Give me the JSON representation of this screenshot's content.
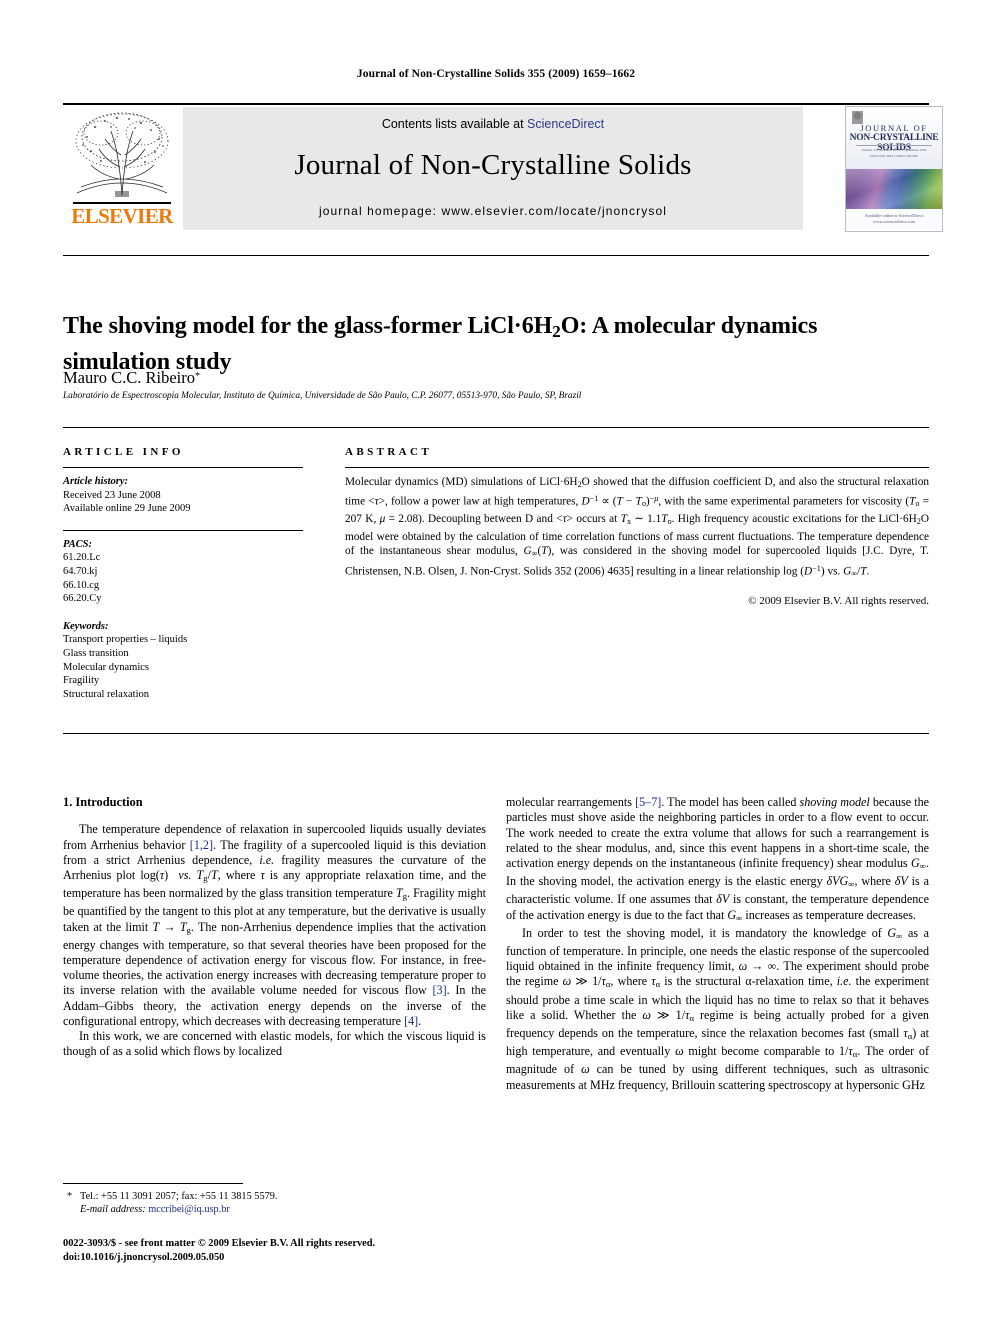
{
  "running_head": "Journal of Non-Crystalline Solids 355 (2009) 1659–1662",
  "masthead": {
    "contents_prefix": "Contents lists available at ",
    "sciencedirect": "ScienceDirect",
    "journal_title": "Journal of Non-Crystalline Solids",
    "homepage": "journal homepage: www.elsevier.com/locate/jnoncrysol",
    "elsevier_wordmark": "ELSEVIER",
    "accent_orange": "#ec7a08",
    "link_blue": "#2b3a8f",
    "band_gray": "#e8e8e8"
  },
  "cover": {
    "line1": "JOURNAL OF",
    "line2": "NON-CRYSTALLINE SOLIDS",
    "meta1": "Volume 355  Numbers 34–36  1 September 2009",
    "meta2": "ISSN 0022-3093  CODEN JNCSBJ",
    "bottom": "Available online at\nScienceDirect\nwww.sciencedirect.com"
  },
  "article": {
    "title_html": "The shoving model for the glass-former LiCl·6H<sub>2</sub>O: A molecular dynamics simulation study",
    "author": "Mauro C.C. Ribeiro",
    "author_marker": "*",
    "affiliation": "Laboratório de Espectroscopia Molecular, Instituto de Química, Universidade de São Paulo, C.P. 26077, 05513-970, São Paulo, SP, Brazil"
  },
  "article_info": {
    "heading": "ARTICLE INFO",
    "history_label": "Article history:",
    "history": [
      "Received 23 June 2008",
      "Available online 29 June 2009"
    ],
    "pacs_label": "PACS:",
    "pacs": [
      "61.20.Lc",
      "64.70.kj",
      "66.10.cg",
      "66.20.Cy"
    ],
    "keywords_label": "Keywords:",
    "keywords": [
      "Transport properties – liquids",
      "Glass transition",
      "Molecular dynamics",
      "Fragility",
      "Structural relaxation"
    ]
  },
  "abstract": {
    "heading": "ABSTRACT",
    "text_html": "Molecular dynamics (MD) simulations of LiCl·6H<sub>2</sub>O showed that the diffusion coefficient D, and also the structural relaxation time &lt;<i class=\"var\">τ</i>&gt;, follow a power law at high temperatures, <i class=\"var\">D</i><sup>−1</sup> ∝ (<i class=\"var\">T</i> − <i class=\"var\">T</i><sub>o</sub>)<sup>−<i class=\"var\">μ</i></sup>, with the same experimental parameters for viscosity (<i class=\"var\">T</i><sub>o</sub> = 207 K, <i class=\"var\">μ</i> = 2.08). Decoupling between D and &lt;<i class=\"var\">τ</i>&gt; occurs at <i class=\"var\">T</i><sub>x</sub> ∼ 1.1<i class=\"var\">T</i><sub>o</sub>. High frequency acoustic excitations for the LiCl·6H<sub>2</sub>O model were obtained by the calculation of time correlation functions of mass current fluctuations. The temperature dependence of the instantaneous shear modulus, <i class=\"var\">G</i><sub>∞</sub>(<i class=\"var\">T</i>), was considered in the shoving model for supercooled liquids [J.C. Dyre, T. Christensen, N.B. Olsen, J. Non-Cryst. Solids 352 (2006) 4635] resulting in a linear relationship log (<i class=\"var\">D</i><sup>−1</sup>) vs. <i class=\"var\">G</i><sub>∞</sub>/<i class=\"var\">T</i>.",
    "copyright": "© 2009 Elsevier B.V. All rights reserved."
  },
  "body": {
    "section_number_title": "1. Introduction",
    "left_paragraphs_html": [
      "The temperature dependence of relaxation in supercooled liquids usually deviates from Arrhenius behavior <span class=\"ref\">[1,2]</span>. The fragility of a supercooled liquid is this deviation from a strict Arrhenius dependence, <i>i.e.</i> fragility measures the curvature of the Arrhenius plot log(<i class=\"var\">τ</i>) &nbsp;<i>vs.</i> <i class=\"var\">T</i><sub>g</sub>/<i class=\"var\">T</i>, where <i class=\"var\">τ</i> is any appropriate relaxation time, and the temperature has been normalized by the glass transition temperature <i class=\"var\">T</i><sub>g</sub>. Fragility might be quantified by the tangent to this plot at any temperature, but the derivative is usually taken at the limit <i class=\"var\">T</i> → <i class=\"var\">T</i><sub>g</sub>. The non-Arrhenius dependence implies that the activation energy changes with temperature, so that several theories have been proposed for the temperature dependence of activation energy for viscous flow. For instance, in free-volume theories, the activation energy increases with decreasing temperature proper to its inverse relation with the available volume needed for viscous flow <span class=\"ref\">[3]</span>. In the Addam–Gibbs theory, the activation energy depends on the inverse of the configurational entropy, which decreases with decreasing temperature <span class=\"ref\">[4]</span>.",
      "In this work, we are concerned with elastic models, for which the viscous liquid is though of as a solid which flows by localized"
    ],
    "right_paragraphs_html": [
      "molecular rearrangements <span class=\"ref\">[5–7]</span>. The model has been called <i>shoving model</i> because the particles must shove aside the neighboring particles in order to a flow event to occur. The work needed to create the extra volume that allows for such a rearrangement is related to the shear modulus, and, since this event happens in a short-time scale, the activation energy depends on the instantaneous (infinite frequency) shear modulus <i class=\"var\">G</i><sub>∞</sub>. In the shoving model, the activation energy is the elastic energy <i>δVG</i><sub>∞</sub>, where <i>δV</i> is a characteristic volume. If one assumes that <i>δV</i> is constant, the temperature dependence of the activation energy is due to the fact that <i class=\"var\">G</i><sub>∞</sub> increases as temperature decreases.",
      "In order to test the shoving model, it is mandatory the knowledge of <i class=\"var\">G</i><sub>∞</sub> as a function of temperature. In principle, one needs the elastic response of the supercooled liquid obtained in the infinite frequency limit, <i class=\"var\">ω</i> → ∞. The experiment should probe the regime <i class=\"var\">ω</i> ≫ 1/<i class=\"var\">τ</i><sub>α</sub>, where <i class=\"var\">τ</i><sub>α</sub> is the structural α-relaxation time, <i>i.e.</i> the experiment should probe a time scale in which the liquid has no time to relax so that it behaves like a solid. Whether the <i class=\"var\">ω</i> ≫ 1/<i class=\"var\">τ</i><sub>α</sub> regime is being actually probed for a given frequency depends on the temperature, since the relaxation becomes fast (small <i class=\"var\">τ</i><sub>α</sub>) at high temperature, and eventually <i class=\"var\">ω</i> might become comparable to 1/<i class=\"var\">τ</i><sub>α</sub>. The order of magnitude of <i class=\"var\">ω</i> can be tuned by using different techniques, such as ultrasonic measurements at MHz frequency, Brillouin scattering spectroscopy at hypersonic GHz"
    ]
  },
  "footnote": {
    "marker": "*",
    "line1": "Tel.: +55 11 3091 2057; fax: +55 11 3815 5579.",
    "email_label": "E-mail address:",
    "email": "mccribei@iq.usp.br"
  },
  "issn_line": {
    "line1": "0022-3093/$ - see front matter © 2009 Elsevier B.V. All rights reserved.",
    "line2": "doi:10.1016/j.jnoncrysol.2009.05.050"
  }
}
